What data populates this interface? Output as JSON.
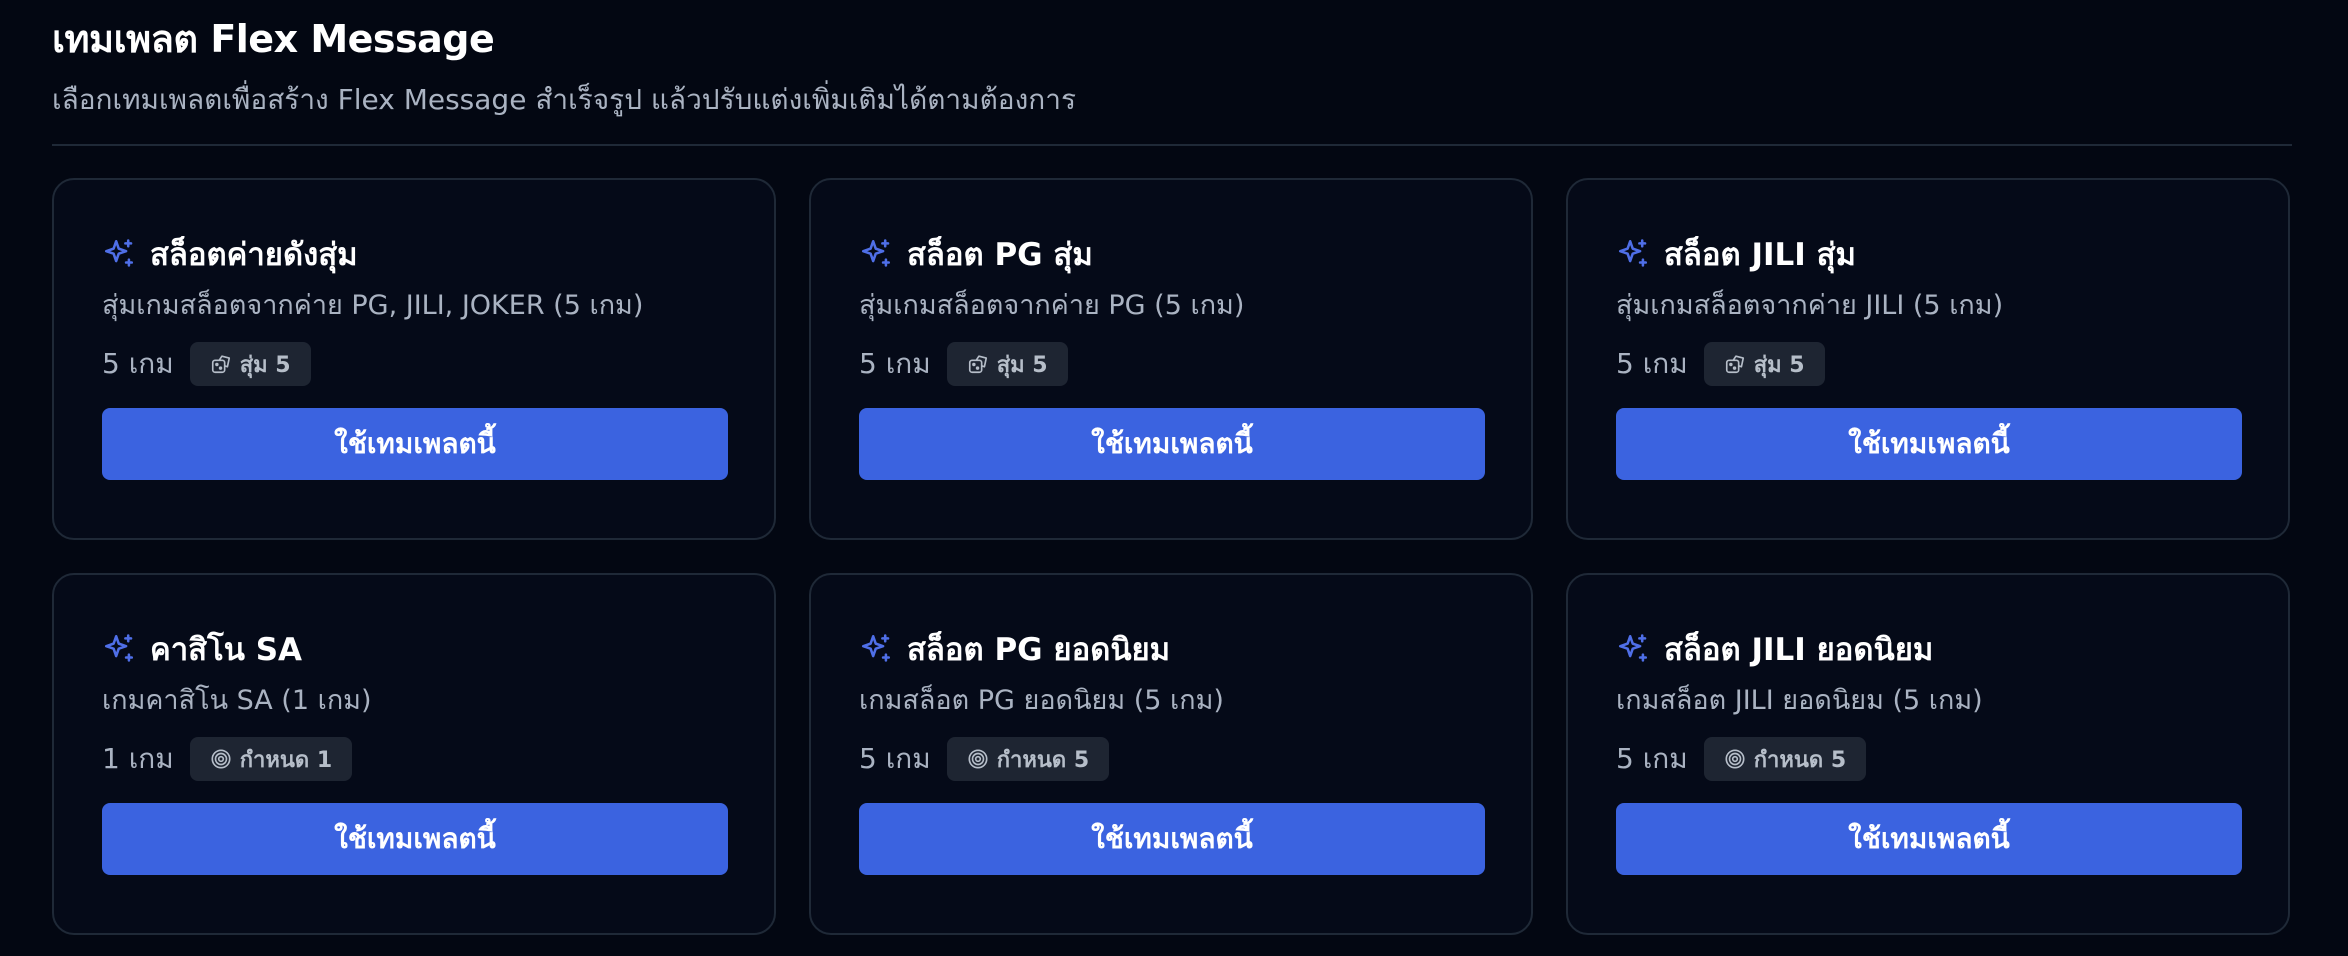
{
  "header": {
    "title": "เทมเพลต Flex Message",
    "subtitle": "เลือกเทมเพลตเพื่อสร้าง Flex Message สำเร็จรูป แล้วปรับแต่งเพิ่มเติมได้ตามต้องการ"
  },
  "colors": {
    "background": "#030712",
    "card": "#050a18",
    "card_border": "#1f2937",
    "accent": "#3b63e0",
    "sparkle": "#4f6fe8"
  },
  "templates": [
    {
      "icon": "sparkle-icon",
      "title": "สล็อตค่ายดังสุ่ม",
      "description": "สุ่มเกมสล็อตจากค่าย PG, JILI, JOKER (5 เกม)",
      "count": "5 เกม",
      "badge_icon": "dice-icon",
      "badge": "สุ่ม 5",
      "button": "ใช้เทมเพลตนี้"
    },
    {
      "icon": "sparkle-icon",
      "title": "สล็อต PG สุ่ม",
      "description": "สุ่มเกมสล็อตจากค่าย PG (5 เกม)",
      "count": "5 เกม",
      "badge_icon": "dice-icon",
      "badge": "สุ่ม 5",
      "button": "ใช้เทมเพลตนี้"
    },
    {
      "icon": "sparkle-icon",
      "title": "สล็อต JILI สุ่ม",
      "description": "สุ่มเกมสล็อตจากค่าย JILI (5 เกม)",
      "count": "5 เกม",
      "badge_icon": "dice-icon",
      "badge": "สุ่ม 5",
      "button": "ใช้เทมเพลตนี้"
    },
    {
      "icon": "sparkle-icon",
      "title": "คาสิโน SA",
      "description": "เกมคาสิโน SA (1 เกม)",
      "count": "1 เกม",
      "badge_icon": "target-icon",
      "badge": "กำหนด 1",
      "button": "ใช้เทมเพลตนี้"
    },
    {
      "icon": "sparkle-icon",
      "title": "สล็อต PG ยอดนิยม",
      "description": "เกมสล็อต PG ยอดนิยม (5 เกม)",
      "count": "5 เกม",
      "badge_icon": "target-icon",
      "badge": "กำหนด 5",
      "button": "ใช้เทมเพลตนี้"
    },
    {
      "icon": "sparkle-icon",
      "title": "สล็อต JILI ยอดนิยม",
      "description": "เกมสล็อต JILI ยอดนิยม (5 เกม)",
      "count": "5 เกม",
      "badge_icon": "target-icon",
      "badge": "กำหนด 5",
      "button": "ใช้เทมเพลตนี้"
    }
  ]
}
